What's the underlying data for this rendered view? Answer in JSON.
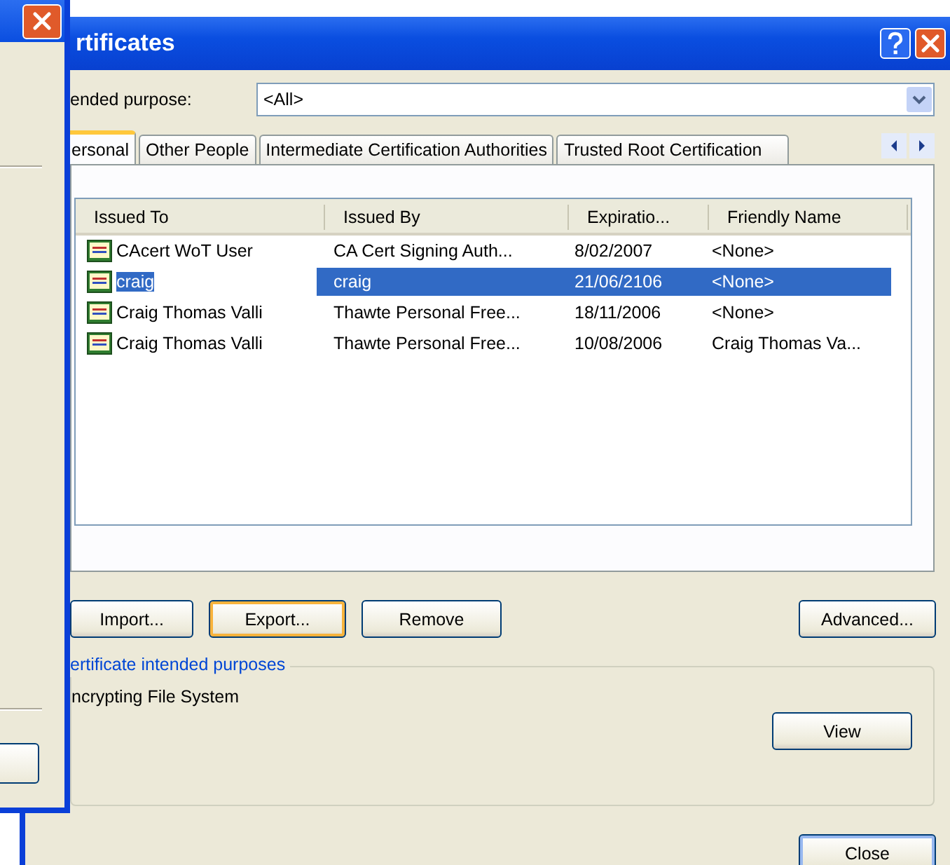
{
  "window": {
    "title": "rtificates"
  },
  "purpose": {
    "label": "ended purpose:",
    "value": "<All>"
  },
  "tabs": [
    {
      "label": "ersonal",
      "selected": true
    },
    {
      "label": "Other People",
      "selected": false
    },
    {
      "label": "Intermediate Certification Authorities",
      "selected": false
    },
    {
      "label": "Trusted Root Certification",
      "selected": false
    }
  ],
  "table": {
    "columns": [
      "Issued To",
      "Issued By",
      "Expiratio...",
      "Friendly Name"
    ],
    "rows": [
      {
        "cells": [
          "CAcert WoT User",
          "CA Cert Signing Auth...",
          "8/02/2007",
          "<None>"
        ],
        "selected": false
      },
      {
        "cells": [
          "craig",
          "craig",
          "21/06/2106",
          "<None>"
        ],
        "selected": true
      },
      {
        "cells": [
          "Craig Thomas Valli",
          "Thawte Personal Free...",
          "18/11/2006",
          "<None>"
        ],
        "selected": false
      },
      {
        "cells": [
          "Craig Thomas Valli",
          "Thawte Personal Free...",
          "10/08/2006",
          "Craig Thomas Va..."
        ],
        "selected": false
      }
    ]
  },
  "actions": [
    {
      "label": "Import...",
      "focused": false
    },
    {
      "label": "Export...",
      "focused": true
    },
    {
      "label": "Remove",
      "focused": false
    }
  ],
  "advanced": {
    "label": "Advanced...",
    "focused": false
  },
  "purposes_group": {
    "title": "ertificate intended purposes",
    "text": "ncrypting File System",
    "button": "View"
  },
  "close_button": "Close"
}
